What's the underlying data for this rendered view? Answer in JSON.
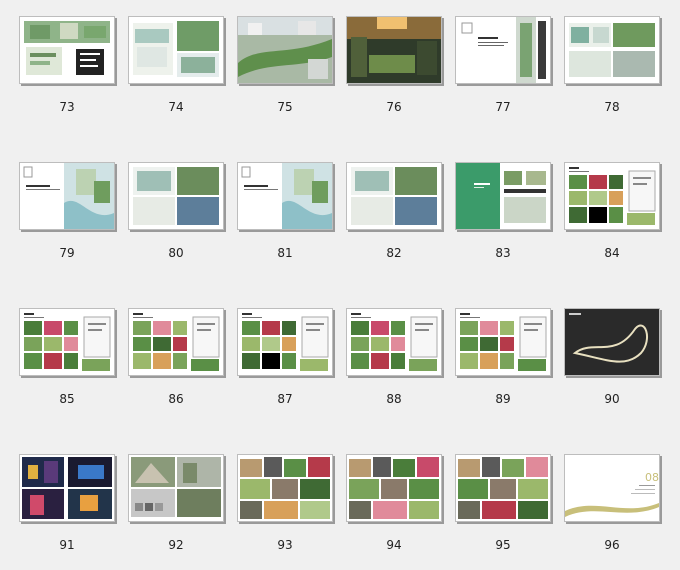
{
  "pages": [
    {
      "number": "73",
      "kind": "plan-mix"
    },
    {
      "number": "74",
      "kind": "board-plan"
    },
    {
      "number": "75",
      "kind": "aerial"
    },
    {
      "number": "76",
      "kind": "photo-dark"
    },
    {
      "number": "77",
      "kind": "text-right-strip"
    },
    {
      "number": "78",
      "kind": "board-photo"
    },
    {
      "number": "79",
      "kind": "title-map"
    },
    {
      "number": "80",
      "kind": "board-quad"
    },
    {
      "number": "81",
      "kind": "title-map"
    },
    {
      "number": "82",
      "kind": "board-quad"
    },
    {
      "number": "83",
      "kind": "green-cover"
    },
    {
      "number": "84",
      "kind": "photo-grid-text"
    },
    {
      "number": "85",
      "kind": "photo-grid-text"
    },
    {
      "number": "86",
      "kind": "photo-grid-text"
    },
    {
      "number": "87",
      "kind": "photo-grid-text"
    },
    {
      "number": "88",
      "kind": "photo-grid-text"
    },
    {
      "number": "89",
      "kind": "photo-grid-text"
    },
    {
      "number": "90",
      "kind": "night-sketch"
    },
    {
      "number": "91",
      "kind": "night-photos"
    },
    {
      "number": "92",
      "kind": "photo-grid-gray"
    },
    {
      "number": "93",
      "kind": "photo-collage"
    },
    {
      "number": "94",
      "kind": "photo-collage"
    },
    {
      "number": "95",
      "kind": "photo-collage"
    },
    {
      "number": "96",
      "kind": "chapter-cover"
    }
  ],
  "chapter_label": "08",
  "colors": {
    "background": "#f0f0f0",
    "cover_green": "#3b9b6a",
    "chapter_olive": "#c8bf7a",
    "night": "#2a2a2a"
  }
}
